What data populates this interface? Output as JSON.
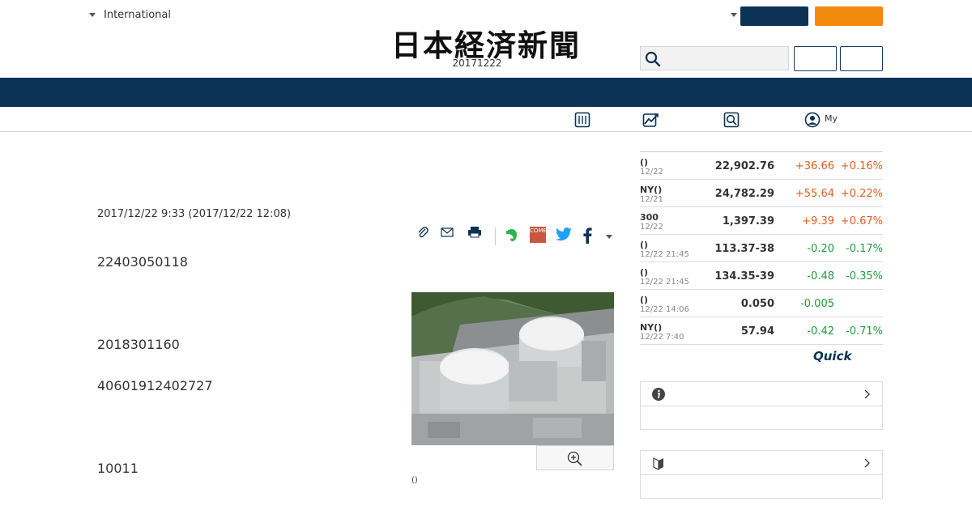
{
  "header": {
    "region": "International",
    "logo": "日本経済新聞",
    "date": "20171222"
  },
  "subnav": {
    "my_label": "My"
  },
  "article": {
    "timestamp": "2017/12/22 9:33 (2017/12/22 12:08)",
    "paragraphs": [
      "22403050118",
      "2018301160",
      "40601912402727",
      "10011"
    ],
    "photo_caption": "()",
    "share_icons": [
      "clip-icon",
      "mail-icon",
      "print-icon",
      "evernote-icon",
      "come-icon",
      "twitter-icon",
      "facebook-icon",
      "more-icon"
    ],
    "come_text": "COME"
  },
  "market": {
    "rows": [
      {
        "name": "()",
        "time": "12/22",
        "value": "22,902.76",
        "change": "+36.66",
        "pct": "+0.16%",
        "dir": "up"
      },
      {
        "name": "NY()",
        "time": "12/21",
        "value": "24,782.29",
        "change": "+55.64",
        "pct": "+0.22%",
        "dir": "up"
      },
      {
        "name": "300",
        "time": "12/22",
        "value": "1,397.39",
        "change": "+9.39",
        "pct": "+0.67%",
        "dir": "up"
      },
      {
        "name": "()",
        "time": "12/22 21:45",
        "value": "113.37-38",
        "change": "-0.20",
        "pct": "-0.17%",
        "dir": "down"
      },
      {
        "name": "()",
        "time": "12/22 21:45",
        "value": "134.35-39",
        "change": "-0.48",
        "pct": "-0.35%",
        "dir": "down"
      },
      {
        "name": "()",
        "time": "12/22 14:06",
        "value": "0.050",
        "change": "-0.005",
        "pct": "",
        "dir": "down"
      },
      {
        "name": "NY()",
        "time": "12/22 7:40",
        "value": "57.94",
        "change": "-0.42",
        "pct": "-0.71%",
        "dir": "down"
      }
    ],
    "provider": "Quick"
  },
  "colors": {
    "navy": "#0c3256",
    "orange": "#f28a0e",
    "up": "#e25e1f",
    "down": "#1f9b3e"
  }
}
